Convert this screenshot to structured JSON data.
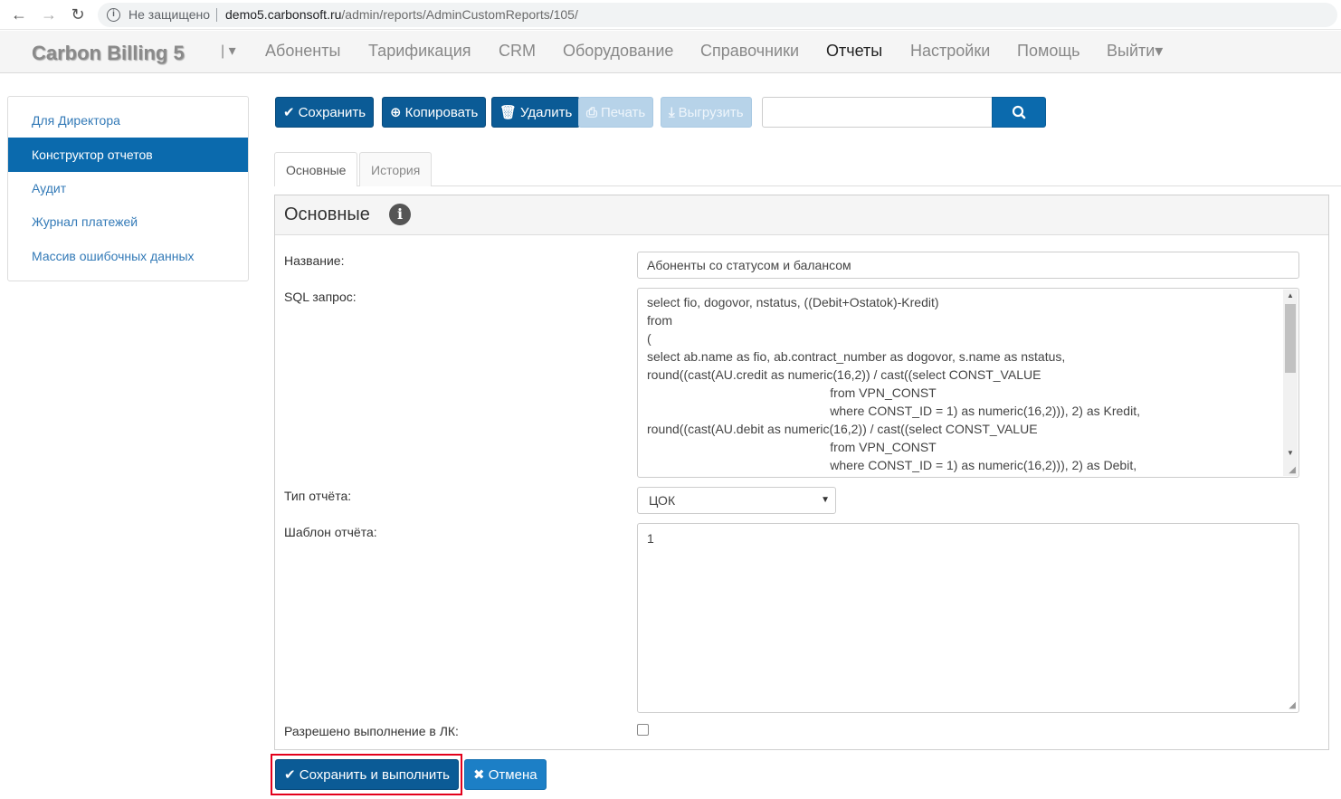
{
  "browser": {
    "back": "←",
    "forward": "→",
    "reload": "↻",
    "insecure_label": "Не защищено",
    "url_host": "demo5.carbonsoft.ru",
    "url_path": "/admin/reports/AdminCustomReports/105/"
  },
  "navbar": {
    "brand": "Carbon Billing 5",
    "brand_caret": "| ▾",
    "items": [
      "Абоненты",
      "Тарификация",
      "CRM",
      "Оборудование",
      "Справочники",
      "Отчеты",
      "Настройки",
      "Помощь",
      "Выйти▾"
    ],
    "active_item": "Отчеты"
  },
  "sidebar": {
    "items": [
      "Для Директора",
      "Конструктор отчетов",
      "Аудит",
      "Журнал платежей",
      "Массив ошибочных данных"
    ],
    "active_index": 1
  },
  "toolbar": {
    "save": "Сохранить",
    "copy": "Копировать",
    "delete": "Удалить",
    "print": "Печать",
    "export": "Выгрузить",
    "search_value": ""
  },
  "tabs": [
    "Основные",
    "История"
  ],
  "panel": {
    "title": "Основные",
    "info_icon": "i"
  },
  "form": {
    "name_label": "Название:",
    "name_value": "Абоненты со статусом и балансом",
    "sql_label": "SQL запрос:",
    "sql_lines": [
      "select fio, dogovor, nstatus, ((Debit+Ostatok)-Kredit)",
      "from",
      "(",
      "select ab.name as fio, ab.contract_number as dogovor, s.name as nstatus,",
      "round((cast(AU.credit as numeric(16,2)) / cast((select CONST_VALUE",
      "                                                    from VPN_CONST",
      "                                                    where CONST_ID = 1) as numeric(16,2))), 2) as Kredit,",
      "round((cast(AU.debit as numeric(16,2)) / cast((select CONST_VALUE",
      "                                                    from VPN_CONST",
      "                                                    where CONST_ID = 1) as numeric(16,2))), 2) as Debit,"
    ],
    "type_label": "Тип отчёта:",
    "type_value": "ЦОК",
    "template_label": "Шаблон отчёта:",
    "template_value": "1",
    "allow_label": "Разрешено выполнение в ЛК:",
    "allow_checked": false
  },
  "actions": {
    "save_run": "Сохранить и выполнить",
    "cancel": "Отмена"
  },
  "colors": {
    "primary": "#0b5b96",
    "active_sidebar": "#0b6aad",
    "highlight": "#e3001b"
  }
}
